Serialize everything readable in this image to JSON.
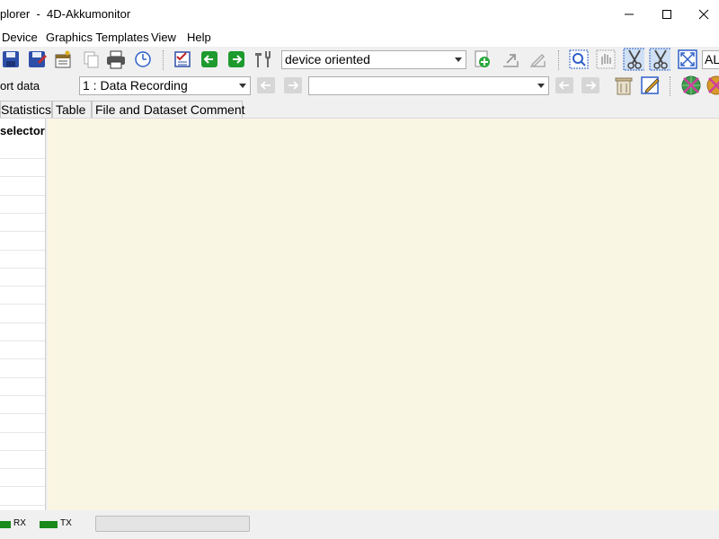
{
  "window": {
    "title": "plorer  -  4D-Akkumonitor"
  },
  "menu": {
    "items": [
      "Device",
      "Graphics Templates",
      "View",
      "Help"
    ]
  },
  "toolbar1": {
    "view_mode_select": "device oriented",
    "all_label": "AL"
  },
  "toolbar2": {
    "export_label": "ort data",
    "record_select": "1 : Data Recording",
    "channel_select": ""
  },
  "tabs": [
    "Statistics",
    "Table",
    "File and Dataset Comment"
  ],
  "left_panel": {
    "header": "selector"
  },
  "status": {
    "rx_label": "RX",
    "tx_label": "TX",
    "progress": 0,
    "led_color": "#1a8a1a"
  }
}
